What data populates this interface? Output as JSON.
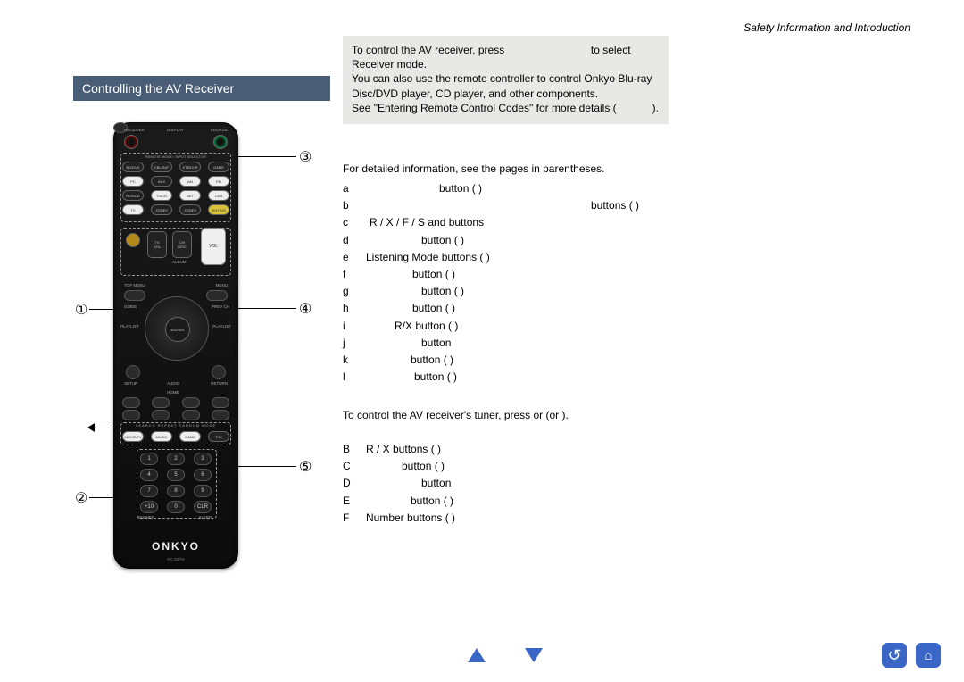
{
  "header": {
    "breadcrumb": "Safety Information and Introduction"
  },
  "section": {
    "title": "Controlling the AV Receiver"
  },
  "infobox": {
    "line1a": "To control the AV receiver, press ",
    "line1b": " to select",
    "line2": "Receiver mode.",
    "line3": "You can also use the remote controller to control Onkyo Blu-ray Disc/DVD player, CD player, and other components.",
    "line4a": "See ",
    "line4b": "\"Entering Remote Control Codes\"",
    "line4c": " for more details (",
    "line4d": ")."
  },
  "detail_intro": "For detailed information, see the pages in parentheses.",
  "items": [
    {
      "k": "a",
      "t": " button (  )"
    },
    {
      "k": "b",
      "t": " buttons (  )"
    },
    {
      "k": "c",
      "t": "R / X / F / S and  buttons"
    },
    {
      "k": "d",
      "t": " button (  )"
    },
    {
      "k": "e",
      "t": "Listening Mode buttons (  )"
    },
    {
      "k": "f",
      "t": " button (  )"
    },
    {
      "k": "g",
      "t": " button (  )"
    },
    {
      "k": "h",
      "t": " button (  )"
    },
    {
      "k": "i",
      "t": " R/X button (  )"
    },
    {
      "k": "j",
      "t": " button"
    },
    {
      "k": "k",
      "t": " button (  )"
    },
    {
      "k": "l",
      "t": " button (  )"
    }
  ],
  "tuner_intro": "To control the AV receiver's tuner, press  or  (or  ).",
  "tuner_items": [
    {
      "k": "B",
      "t": "R / X buttons (  )"
    },
    {
      "k": "C",
      "t": " button (  )"
    },
    {
      "k": "D",
      "t": " button"
    },
    {
      "k": "E",
      "t": " button (  )"
    },
    {
      "k": "F",
      "t": "Number buttons (  )"
    }
  ],
  "remote": {
    "top_labels": {
      "l": "RECEIVER",
      "m": "DISPLAY",
      "r": "SOURCE"
    },
    "mode_strip": "REMOTE MODE / INPUT SELECTOR",
    "grid1": [
      "BD/DVD",
      "CBL/SAT",
      "STB/DVR",
      "GAME",
      "PC",
      "AUX",
      "AM",
      "FM",
      "RCR/CD",
      "TV/CD",
      "NET",
      "USB",
      "TV",
      "ZONE2",
      "ZONE3",
      "MUTING"
    ],
    "mid": {
      "ch": "CH\nDISC",
      "vol_l": "TV\nVOL",
      "vol_r": "VOL",
      "album": "ALBUM"
    },
    "menu_row": {
      "l": "TOP MENU",
      "r": "MENU"
    },
    "nav": {
      "guide": "GUIDE",
      "prev": "PREV CH",
      "playlist_l": "PLAYLIST",
      "playlist_r": "PLAYLIST",
      "enter": "ENTER"
    },
    "below_nav": {
      "setup": "SETUP",
      "audio": "AUDIO",
      "return": "RETURN",
      "home": "HOME"
    },
    "mode_row": {
      "labels": "SEARCH  REPEAT  RANDOM  MODE",
      "btns": [
        "MOVIE/TV",
        "MUSIC",
        "GAME",
        "THX"
      ]
    },
    "nums": [
      "1",
      "2",
      "3",
      "4",
      "5",
      "6",
      "7",
      "8",
      "9",
      "+10",
      "0",
      "CLR"
    ],
    "bottom_row": {
      "l": "DIMMER",
      "r": "SLEEP"
    },
    "brand": "ONKYO",
    "model": "RC-837M"
  },
  "callouts": {
    "c1": "①",
    "c2": "②",
    "c3": "③",
    "c4": "④",
    "c5": "⑤"
  },
  "nav_icons": {
    "back": "↺",
    "home": "⌂"
  }
}
